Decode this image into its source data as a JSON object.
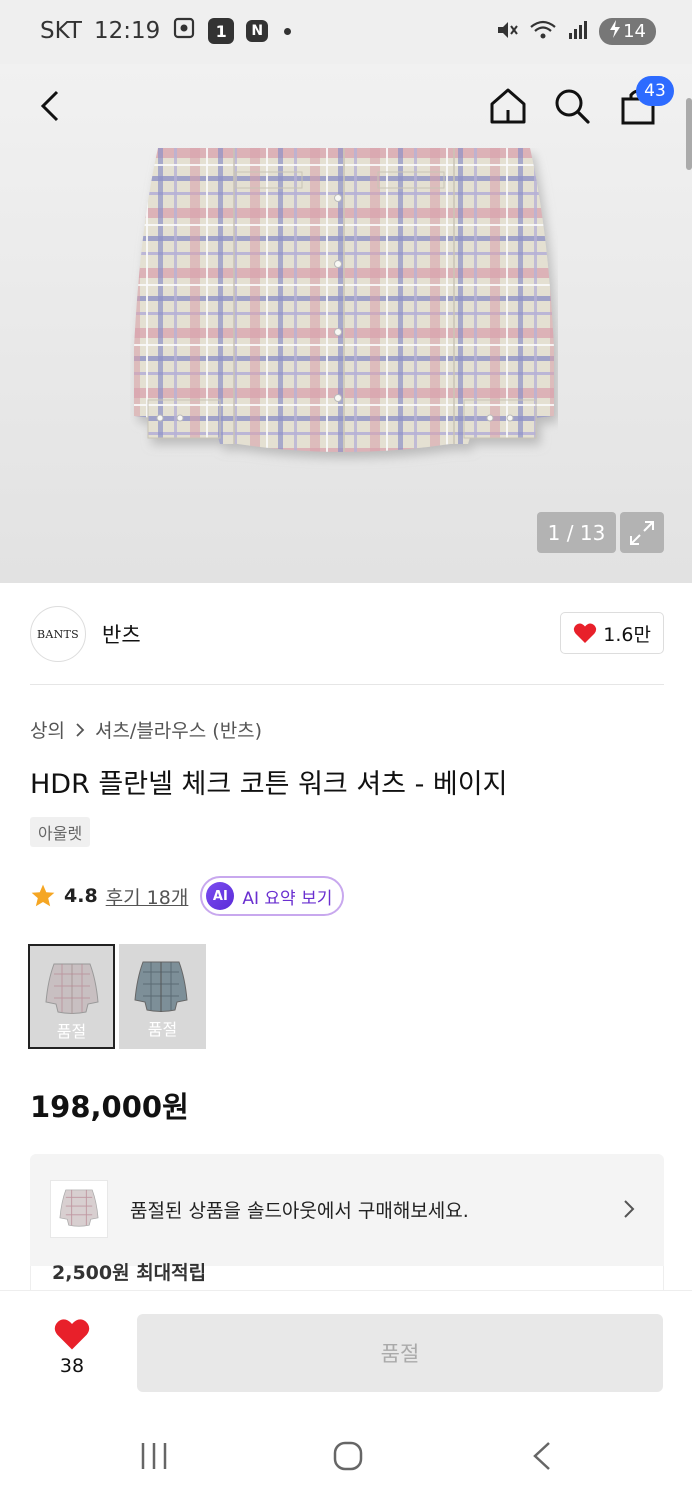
{
  "status_bar": {
    "carrier": "SKT",
    "time": "12:19",
    "badge_num": "1",
    "badge_n": "N",
    "battery": "14"
  },
  "header": {
    "cart_count": "43"
  },
  "gallery": {
    "counter": "1 / 13"
  },
  "brand": {
    "logo_text": "BANTS",
    "name": "반츠",
    "likes": "1.6만"
  },
  "product": {
    "breadcrumb": [
      "상의",
      "셔츠/블라우스 (반츠)"
    ],
    "title": "HDR 플란넬 체크 코튼 워크 셔츠 - 베이지",
    "tag": "아울렛",
    "rating": "4.8",
    "review_label": "후기 18개",
    "ai_badge": "AI",
    "ai_label": "AI 요약 보기",
    "swatches": [
      {
        "label": "품절",
        "selected": true
      },
      {
        "label": "품절",
        "selected": false
      }
    ],
    "price": "198,000원"
  },
  "banner": {
    "text": "품절된 상품을 솔드아웃에서 구매해보세요.",
    "partial_text": "2,500원 최대적립"
  },
  "purchase": {
    "wish_count": "38",
    "buy_label": "품절"
  },
  "colors": {
    "accent_blue": "#2d6bff",
    "heart_red": "#e8202a",
    "star_orange": "#f5a623",
    "ai_purple": "#6a2fd0"
  }
}
